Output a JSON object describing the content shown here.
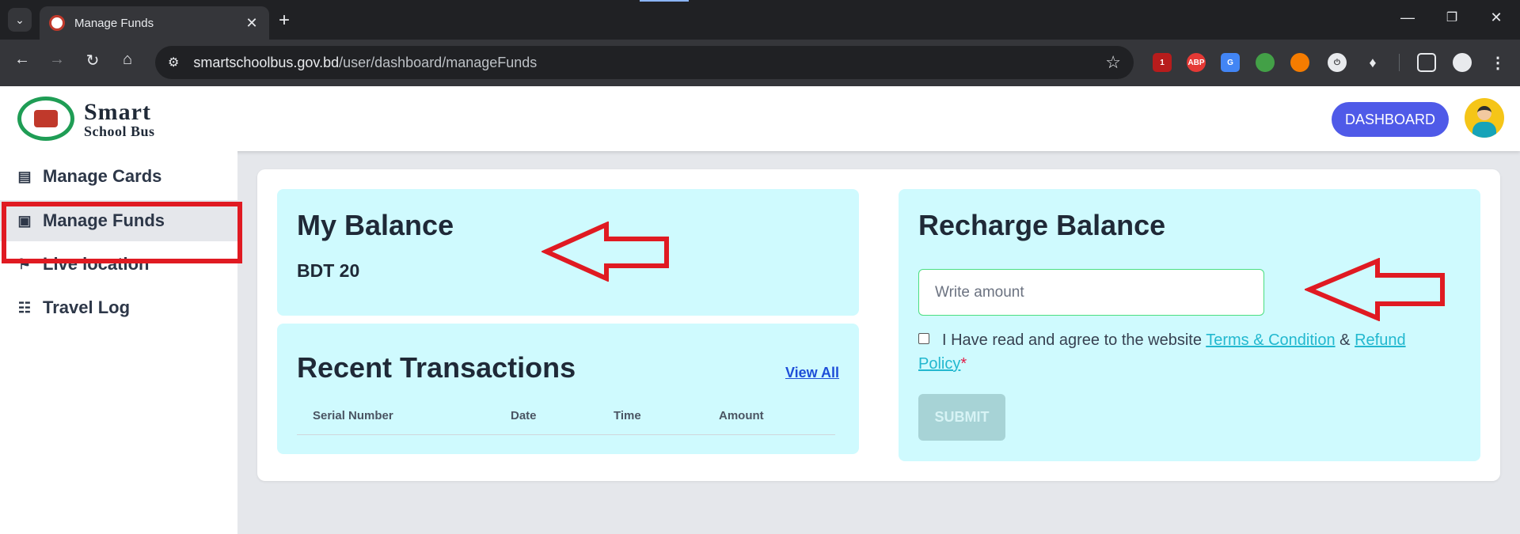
{
  "browser": {
    "tab_title": "Manage Funds",
    "url_host": "smartschoolbus.gov.bd",
    "url_path": "/user/dashboard/manageFunds",
    "extension_badge": "1",
    "ext_abp": "ABP"
  },
  "header": {
    "brand_line1": "Smart",
    "brand_line2": "School Bus",
    "dashboard_label": "DASHBOARD"
  },
  "sidebar": {
    "items": [
      {
        "label": "Manage Cards",
        "icon": "id-card-icon"
      },
      {
        "label": "Manage Funds",
        "icon": "wallet-icon"
      },
      {
        "label": "Live location",
        "icon": "map-icon"
      },
      {
        "label": "Travel Log",
        "icon": "log-book-icon"
      }
    ]
  },
  "balance": {
    "title": "My Balance",
    "value": "BDT 20"
  },
  "transactions": {
    "title": "Recent Transactions",
    "view_all": "View All",
    "columns": [
      "Serial Number",
      "Date",
      "Time",
      "Amount"
    ],
    "rows": []
  },
  "recharge": {
    "title": "Recharge Balance",
    "amount_placeholder": "Write amount",
    "agree_text": "I Have read and agree to the website",
    "terms_link": "Terms & Condition",
    "amp": "&",
    "refund_link": "Refund Policy",
    "required_mark": "*",
    "submit_label": "SUBMIT"
  },
  "colors": {
    "accent": "#4f5ae8",
    "panel_bg": "#cffafe",
    "annotation_red": "#e01a22",
    "link": "#22b8cf"
  }
}
